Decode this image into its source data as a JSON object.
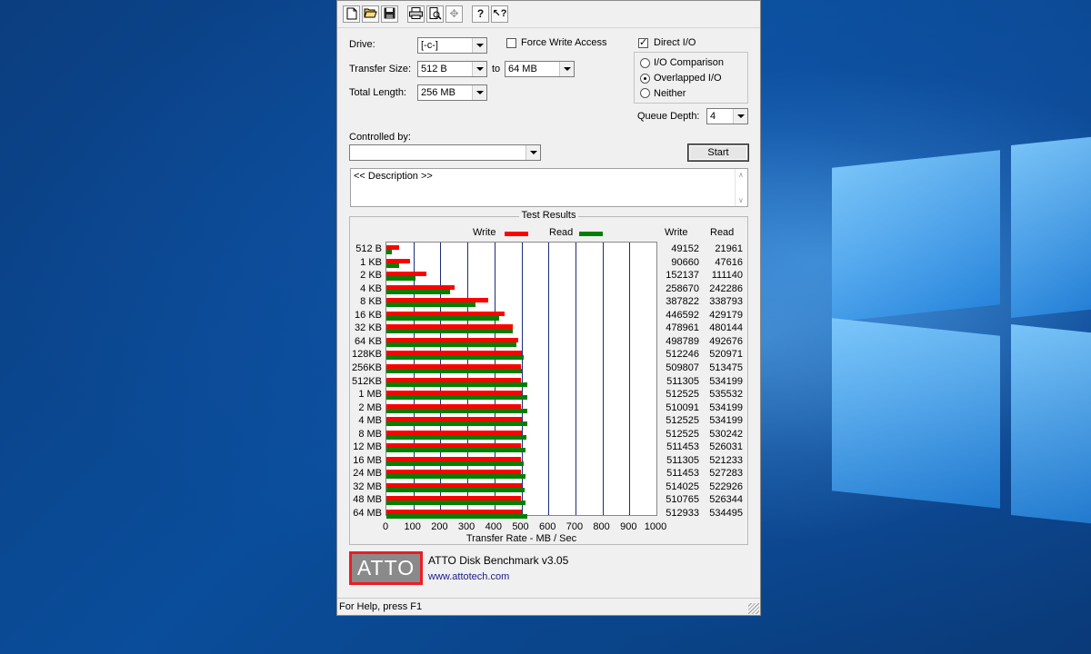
{
  "toolbar": {
    "buttons": [
      {
        "name": "new-icon",
        "glyph": "🗋"
      },
      {
        "name": "open-icon",
        "glyph": "📂"
      },
      {
        "name": "save-icon",
        "glyph": "💾"
      },
      {
        "name": "print-icon",
        "glyph": "🖶"
      },
      {
        "name": "print-preview-icon",
        "glyph": "🔍"
      },
      {
        "name": "move-icon",
        "glyph": "✥"
      },
      {
        "name": "help-icon",
        "glyph": "?"
      },
      {
        "name": "context-help-icon",
        "glyph": "↖?"
      }
    ]
  },
  "settings": {
    "drive_label": "Drive:",
    "drive_value": "[-c-]",
    "transfer_size_label": "Transfer Size:",
    "transfer_from": "512 B",
    "to_label": "to",
    "transfer_to": "64 MB",
    "total_length_label": "Total Length:",
    "total_length_value": "256 MB",
    "force_write_label": "Force Write Access",
    "force_write_checked": false,
    "direct_io_label": "Direct I/O",
    "direct_io_checked": true,
    "io_options": [
      {
        "label": "I/O Comparison",
        "checked": false
      },
      {
        "label": "Overlapped I/O",
        "checked": true
      },
      {
        "label": "Neither",
        "checked": false
      }
    ],
    "queue_depth_label": "Queue Depth:",
    "queue_depth_value": "4",
    "controlled_by_label": "Controlled by:",
    "controlled_by_value": "",
    "start_label": "Start",
    "description": "<< Description >>"
  },
  "results": {
    "title": "Test Results",
    "legend_write": "Write",
    "legend_read": "Read",
    "col_write": "Write",
    "col_read": "Read",
    "colors": {
      "write": "#ff0000",
      "read": "#008000"
    }
  },
  "chart_data": {
    "type": "bar",
    "orientation": "horizontal",
    "xlabel": "Transfer Rate - MB / Sec",
    "xlim": [
      0,
      1000
    ],
    "xticks": [
      "0",
      "100",
      "200",
      "300",
      "400",
      "500",
      "600",
      "700",
      "800",
      "900",
      "1000"
    ],
    "categories": [
      "512 B",
      "1 KB",
      "2 KB",
      "4 KB",
      "8 KB",
      "16 KB",
      "32 KB",
      "64 KB",
      "128KB",
      "256KB",
      "512KB",
      "1 MB",
      "2 MB",
      "4 MB",
      "8 MB",
      "12 MB",
      "16 MB",
      "24 MB",
      "32 MB",
      "48 MB",
      "64 MB"
    ],
    "series": [
      {
        "name": "Write",
        "values": [
          "49152",
          "90660",
          "152137",
          "258670",
          "387822",
          "446592",
          "478961",
          "498789",
          "512246",
          "509807",
          "511305",
          "512525",
          "510091",
          "512525",
          "512525",
          "511453",
          "511305",
          "511453",
          "514025",
          "510765",
          "512933"
        ]
      },
      {
        "name": "Read",
        "values": [
          "21961",
          "47616",
          "111140",
          "242286",
          "338793",
          "429179",
          "480144",
          "492676",
          "520971",
          "513475",
          "534199",
          "535532",
          "534199",
          "534199",
          "530242",
          "526031",
          "521233",
          "527283",
          "522926",
          "526344",
          "534495"
        ]
      }
    ]
  },
  "brand": {
    "logo_text": "ATTO",
    "product": "ATTO Disk Benchmark v3.05",
    "url": "www.attotech.com"
  },
  "status": {
    "text": "For Help, press F1"
  }
}
